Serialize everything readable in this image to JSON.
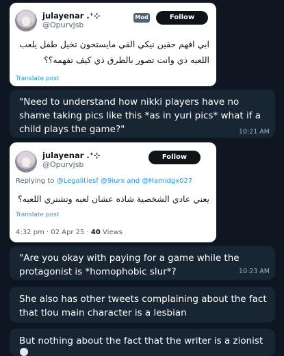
{
  "tweet1": {
    "name": "julayenar .⁺⊹",
    "handle": "@Opurvjsb",
    "badge": "Mod",
    "follow_label": "Follow",
    "text_line1": "ابي افهم حقين نيكي القي مايستحون تخيل طفل يلعب",
    "text_line2": "اللعبه ذي وانت تصور بالطرق ذي كيف تفهمه؟؟",
    "translate_label": "Translate post"
  },
  "message1": {
    "text": "\"Need to understand how nikki players have no shame taking pics like this *as in yuri pics* what if a child plays the game?\"",
    "time": "10:21 AM"
  },
  "tweet2": {
    "name": "julayenar .⁺⊹",
    "handle": "@Opurvjsb",
    "follow_label": "Follow",
    "replying_to_label": "Replying to",
    "mention1": "@Legalitiesf",
    "mention2": "@9iurx",
    "and_label": "and",
    "mention3": "@Hamidgx027",
    "text": "يعني عادي الشخصية شاذه عشان لعبه وتشتري اللعبه؟",
    "translate_label": "Translate post",
    "timestamp": "4:32 pm · 02 Apr 25 ·",
    "views": "40",
    "views_label": "Views"
  },
  "message2": {
    "text": "\"Are you okay with paying for a game while the protagonist is *homophobic slur*?",
    "time": "10:23 AM"
  },
  "message3": {
    "text": "She also has other tweets complaining about the fact that tlou main character is a lesbian"
  },
  "message4": {
    "text": "But nothing about the fact that the writer is a zionist"
  }
}
